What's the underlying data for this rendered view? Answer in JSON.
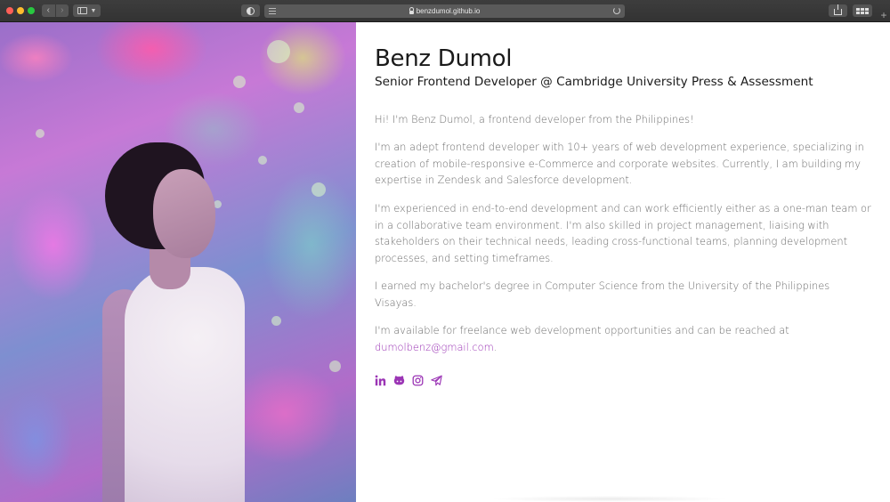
{
  "browser": {
    "url": "benzdumol.github.io"
  },
  "profile": {
    "name": "Benz Dumol",
    "role": "Senior Frontend Developer @ Cambridge University Press & Assessment"
  },
  "bio": {
    "p1": "Hi! I'm Benz Dumol, a frontend developer from the Philippines!",
    "p2": "I'm an adept frontend developer with 10+ years of web development experience, specializing in creation of mobile-responsive e-Commerce and corporate websites. Currently, I am building my expertise in Zendesk and Salesforce development.",
    "p3": "I'm experienced in end-to-end development and can work efficiently either as a one-man team or in a collaborative team environment. I'm also skilled in project management, liaising with stakeholders on their technical needs, leading cross-functional teams, planning development processes, and setting timeframes.",
    "p4": "I earned my bachelor's degree in Computer Science from the University of the Philippines Visayas.",
    "p5_text": "I'm available for freelance web development opportunities and can be reached at ",
    "p5_email": "dumolbenz@gmail.com",
    "p5_end": "."
  },
  "socials": [
    {
      "icon": "linkedin-icon"
    },
    {
      "icon": "github-icon"
    },
    {
      "icon": "instagram-icon"
    },
    {
      "icon": "telegram-icon"
    }
  ],
  "colors": {
    "accent": "#9b35b5",
    "text": "#1a1a1a",
    "muted": "#6c6c6c"
  }
}
